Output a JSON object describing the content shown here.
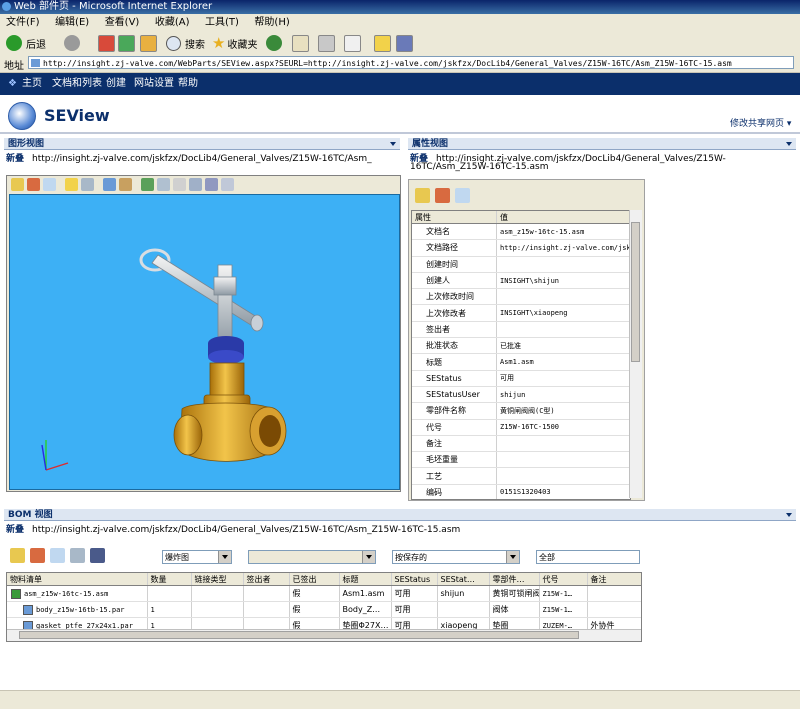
{
  "window": {
    "title": "Web 部件页 - Microsoft Internet Explorer"
  },
  "menu": [
    "文件(F)",
    "编辑(E)",
    "查看(V)",
    "收藏(A)",
    "工具(T)",
    "帮助(H)"
  ],
  "toolbar": {
    "back": "后退",
    "search": "搜索",
    "favorites": "收藏夹"
  },
  "address": {
    "label": "地址",
    "url": "http://insight.zj-valve.com/WebParts/SEView.aspx?SEURL=http://insight.zj-valve.com/jskfzx/DocLib4/General_Valves/Z15W-16TC/Asm_Z15W-16TC-15.asm"
  },
  "nav": {
    "home": "主页",
    "docs": "文档和列表",
    "create": "创建",
    "settings": "网站设置",
    "help": "帮助"
  },
  "site": {
    "title": "SEView",
    "modify": "修改共享网页"
  },
  "graphic": {
    "title": "图形视图",
    "new_label": "新叠",
    "path": "http://insight.zj-valve.com/jskfzx/DocLib4/General_Valves/Z15W-16TC/Asm_"
  },
  "props": {
    "title": "属性视图",
    "new_label": "新叠",
    "path1": "http://insight.zj-valve.com/jskfzx/DocLib4/General_Valves/Z15W-",
    "path2": "16TC/Asm_Z15W-16TC-15.asm",
    "col_key": "属性",
    "col_val": "值",
    "rows": [
      {
        "k": "文档名",
        "v": "asm_z15w-16tc-15.asm"
      },
      {
        "k": "文档路径",
        "v": "http://insight.zj-valve.com/jsk"
      },
      {
        "k": "创建时间",
        "v": ""
      },
      {
        "k": "创建人",
        "v": "INSIGHT\\shijun"
      },
      {
        "k": "上次修改时间",
        "v": ""
      },
      {
        "k": "上次修改者",
        "v": "INSIGHT\\xiaopeng"
      },
      {
        "k": "签出者",
        "v": ""
      },
      {
        "k": "批准状态",
        "v": "已批准"
      },
      {
        "k": "标题",
        "v": "Asm1.asm"
      },
      {
        "k": "SEStatus",
        "v": "可用"
      },
      {
        "k": "SEStatusUser",
        "v": "shijun"
      },
      {
        "k": "零部件名称",
        "v": "黄铜闸阀阀(C型)"
      },
      {
        "k": "代号",
        "v": "Z15W-16TC-1500"
      },
      {
        "k": "备注",
        "v": ""
      },
      {
        "k": "毛坯重量",
        "v": ""
      },
      {
        "k": "工艺",
        "v": ""
      },
      {
        "k": "编码",
        "v": "0151S1320403"
      }
    ]
  },
  "bom": {
    "title": "BOM 视图",
    "new_label": "新叠",
    "path": "http://insight.zj-valve.com/jskfzx/DocLib4/General_Valves/Z15W-16TC/Asm_Z15W-16TC-15.asm",
    "combo1": "爆炸图",
    "combo2": "",
    "combo3": "按保存的",
    "combo4": "全部",
    "headers": [
      "物料清单",
      "数量",
      "链接类型",
      "签出者",
      "已签出",
      "标题",
      "SEStatus",
      "SEStat…",
      "零部件…",
      "代号",
      "备注"
    ],
    "rows": [
      [
        "asm_z15w-16tc-15.asm",
        "",
        "",
        "",
        "假",
        "Asm1.asm",
        "可用",
        "shijun",
        "黄铜可锁闸阀",
        "Z15W-1…",
        ""
      ],
      [
        "body_z15w-16tb-15.par",
        "1",
        "",
        "",
        "假",
        "Body_Z…",
        "可用",
        "",
        "阀体",
        "Z15W-1…",
        ""
      ],
      [
        "gasket_ptfe_27x24x1.par",
        "1",
        "",
        "",
        "假",
        "垫圈Φ27X…",
        "可用",
        "xiaopeng",
        "垫圈",
        "ZUZEM-…",
        "外协件"
      ]
    ]
  }
}
